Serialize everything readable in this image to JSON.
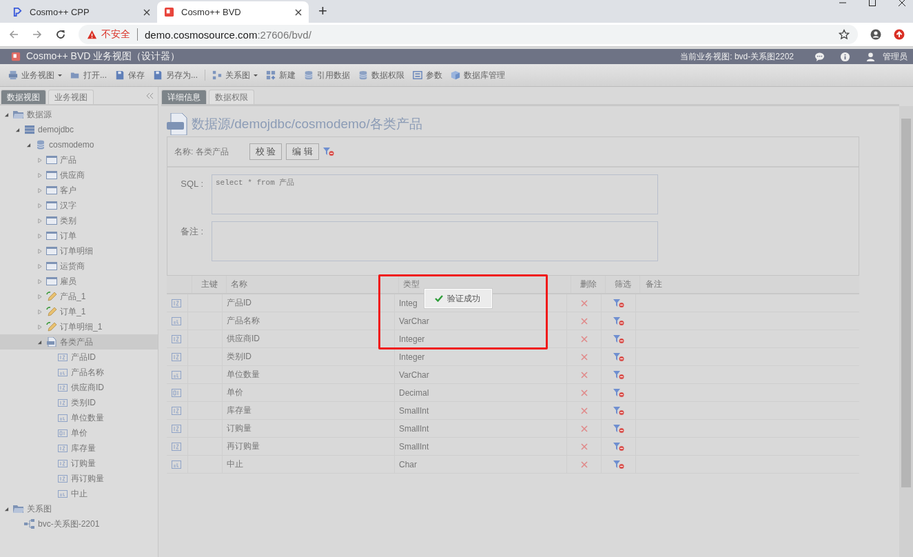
{
  "browser": {
    "tabs": [
      {
        "title": "Cosmo++ CPP",
        "selected": false,
        "kind": "cpp"
      },
      {
        "title": "Cosmo++ BVD",
        "selected": true,
        "kind": "bvd"
      }
    ],
    "new_tab": "+",
    "security": "不安全",
    "url_host": "demo.cosmosource.com",
    "url_rest": ":27606/bvd/"
  },
  "app": {
    "title": "Cosmo++ BVD 业务视图（设计器）",
    "current_view": "当前业务视图: bvd-关系图2202",
    "user": "管理员"
  },
  "toolbar": [
    {
      "label": "业务视图",
      "kind": "view",
      "dropdown": true,
      "separator_before": false
    },
    {
      "label": "打开...",
      "kind": "open",
      "dropdown": false,
      "separator_before": false
    },
    {
      "label": "保存",
      "kind": "save",
      "dropdown": false,
      "separator_before": false
    },
    {
      "label": "另存为...",
      "kind": "save",
      "dropdown": false,
      "separator_before": false
    },
    {
      "label": "关系图",
      "kind": "diagram",
      "dropdown": true,
      "separator_before": true
    },
    {
      "label": "新建",
      "kind": "new",
      "dropdown": false,
      "separator_before": false
    },
    {
      "label": "引用数据",
      "kind": "data",
      "dropdown": false,
      "separator_before": false
    },
    {
      "label": "数据权限",
      "kind": "data",
      "dropdown": false,
      "separator_before": false
    },
    {
      "label": "参数",
      "kind": "param",
      "dropdown": false,
      "separator_before": false
    },
    {
      "label": "数据库管理",
      "kind": "cube",
      "dropdown": false,
      "separator_before": false
    }
  ],
  "sidebar": {
    "tabs": [
      {
        "label": "数据视图",
        "selected": true
      },
      {
        "label": "业务视图",
        "selected": false
      }
    ],
    "tree": [
      {
        "label": "数据源",
        "kind": "folder",
        "expanded": true,
        "selected": false,
        "children": [
          {
            "label": "demojdbc",
            "kind": "server",
            "expanded": true,
            "selected": false,
            "children": [
              {
                "label": "cosmodemo",
                "kind": "database",
                "expanded": true,
                "selected": false,
                "children": [
                  {
                    "label": "产品",
                    "kind": "table",
                    "expanded": false,
                    "selected": false
                  },
                  {
                    "label": "供应商",
                    "kind": "table",
                    "expanded": false,
                    "selected": false
                  },
                  {
                    "label": "客户",
                    "kind": "table",
                    "expanded": false,
                    "selected": false
                  },
                  {
                    "label": "汉字",
                    "kind": "table",
                    "expanded": false,
                    "selected": false
                  },
                  {
                    "label": "类别",
                    "kind": "table",
                    "expanded": false,
                    "selected": false
                  },
                  {
                    "label": "订单",
                    "kind": "table",
                    "expanded": false,
                    "selected": false
                  },
                  {
                    "label": "订单明细",
                    "kind": "table",
                    "expanded": false,
                    "selected": false
                  },
                  {
                    "label": "运货商",
                    "kind": "table",
                    "expanded": false,
                    "selected": false
                  },
                  {
                    "label": "雇员",
                    "kind": "table",
                    "expanded": false,
                    "selected": false
                  },
                  {
                    "label": "产品_1",
                    "kind": "view",
                    "expanded": false,
                    "selected": false
                  },
                  {
                    "label": "订单_1",
                    "kind": "view",
                    "expanded": false,
                    "selected": false
                  },
                  {
                    "label": "订单明细_1",
                    "kind": "view",
                    "expanded": false,
                    "selected": false
                  },
                  {
                    "label": "各类产品",
                    "kind": "sql",
                    "expanded": true,
                    "selected": true,
                    "children": [
                      {
                        "label": "产品ID",
                        "kind": "int",
                        "selected": false
                      },
                      {
                        "label": "产品名称",
                        "kind": "text",
                        "selected": false
                      },
                      {
                        "label": "供应商ID",
                        "kind": "int",
                        "selected": false
                      },
                      {
                        "label": "类别ID",
                        "kind": "int",
                        "selected": false
                      },
                      {
                        "label": "单位数量",
                        "kind": "text",
                        "selected": false
                      },
                      {
                        "label": "单价",
                        "kind": "decimal",
                        "selected": false
                      },
                      {
                        "label": "库存量",
                        "kind": "int",
                        "selected": false
                      },
                      {
                        "label": "订购量",
                        "kind": "int",
                        "selected": false
                      },
                      {
                        "label": "再订购量",
                        "kind": "int",
                        "selected": false
                      },
                      {
                        "label": "中止",
                        "kind": "text",
                        "selected": false
                      }
                    ]
                  }
                ]
              }
            ]
          }
        ]
      },
      {
        "label": "关系图",
        "kind": "folder",
        "expanded": true,
        "selected": false,
        "children": [
          {
            "label": "bvc-关系图-2201",
            "kind": "diagram",
            "selected": false
          }
        ]
      }
    ]
  },
  "main": {
    "tabs": [
      {
        "label": "详细信息",
        "selected": true
      },
      {
        "label": "数据权限",
        "selected": false
      }
    ],
    "title": "数据源/demojdbc/cosmodemo/各类产品",
    "name_label": "名称: 各类产品",
    "buttons": [
      "校 验",
      "编 辑"
    ],
    "sql_label": "SQL :",
    "sql": "select * from 产品",
    "note_label": "备注 :",
    "columns": [
      "主键",
      "名称",
      "类型",
      "删除",
      "筛选",
      "备注"
    ],
    "rows": [
      {
        "kind": "int",
        "name": "产品ID",
        "type": "Integ"
      },
      {
        "kind": "text",
        "name": "产品名称",
        "type": "VarChar"
      },
      {
        "kind": "int",
        "name": "供应商ID",
        "type": "Integer"
      },
      {
        "kind": "int",
        "name": "类别ID",
        "type": "Integer"
      },
      {
        "kind": "text",
        "name": "单位数量",
        "type": "VarChar"
      },
      {
        "kind": "decimal",
        "name": "单价",
        "type": "Decimal"
      },
      {
        "kind": "int",
        "name": "库存量",
        "type": "SmallInt"
      },
      {
        "kind": "int",
        "name": "订购量",
        "type": "SmallInt"
      },
      {
        "kind": "int",
        "name": "再订购量",
        "type": "SmallInt"
      },
      {
        "kind": "text",
        "name": "中止",
        "type": "Char"
      }
    ],
    "toast": "验证成功"
  }
}
